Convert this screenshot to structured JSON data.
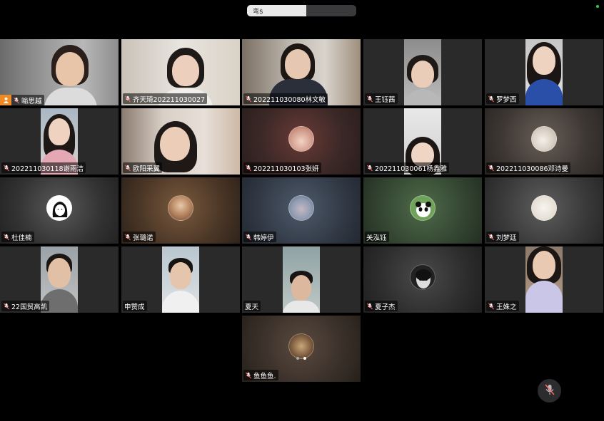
{
  "top_bar": {
    "segment_label": "弯$"
  },
  "participants": [
    {
      "name": "喻思越",
      "host": true
    },
    {
      "name": "齐天琦202211030027"
    },
    {
      "name": "202211030080林文敏"
    },
    {
      "name": "王钰茜"
    },
    {
      "name": "罗梦西"
    },
    {
      "name": "202211030118谢雨洁"
    },
    {
      "name": "欧阳采翼"
    },
    {
      "name": "202211030103张妍"
    },
    {
      "name": "202211030061杨鑫雅"
    },
    {
      "name": "202211030086邓诗曼"
    },
    {
      "name": "杜佳楠"
    },
    {
      "name": "张璐诺"
    },
    {
      "name": "韩婷伊"
    },
    {
      "name": "关泓钰",
      "no_mic_icon": true
    },
    {
      "name": "刘梦廷"
    },
    {
      "name": "22国贸高凯"
    },
    {
      "name": "申赞成",
      "no_mic_icon": true
    },
    {
      "name": "夏天",
      "no_mic_icon": true
    },
    {
      "name": "夏子杰"
    },
    {
      "name": "王姝之"
    },
    {
      "name": "鱼鱼鱼."
    }
  ],
  "colors": {
    "host_badge": "#f08a24",
    "mic_muted": "#ff6b6b",
    "background": "#000000"
  },
  "icons": {
    "mic_muted": "mic-muted-icon",
    "host": "person-icon",
    "mute_button": "mic-off-icon"
  }
}
